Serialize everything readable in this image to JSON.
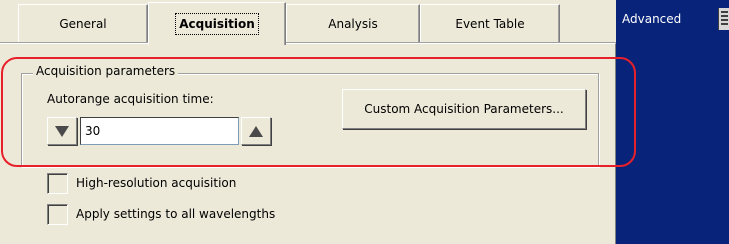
{
  "tabs": [
    {
      "label": "General",
      "active": false
    },
    {
      "label": "Acquisition",
      "active": true
    },
    {
      "label": "Analysis",
      "active": false
    },
    {
      "label": "Event Table",
      "active": false
    }
  ],
  "side_panel": {
    "label": "Advanced",
    "icon": "grip-icon",
    "background_color": "#08237a"
  },
  "acquisition_group": {
    "legend": "Acquisition parameters",
    "autorange_label": "Autorange acquisition time:",
    "time_value": "30",
    "decrement_icon": "triangle-down-icon",
    "increment_icon": "triangle-up-icon",
    "custom_button_label": "Custom Acquisition Parameters..."
  },
  "options": {
    "high_resolution": {
      "label": "High-resolution acquisition",
      "checked": false
    },
    "apply_all": {
      "label": "Apply settings to all wavelengths",
      "checked": false
    }
  },
  "highlight_color": "#e8202a"
}
